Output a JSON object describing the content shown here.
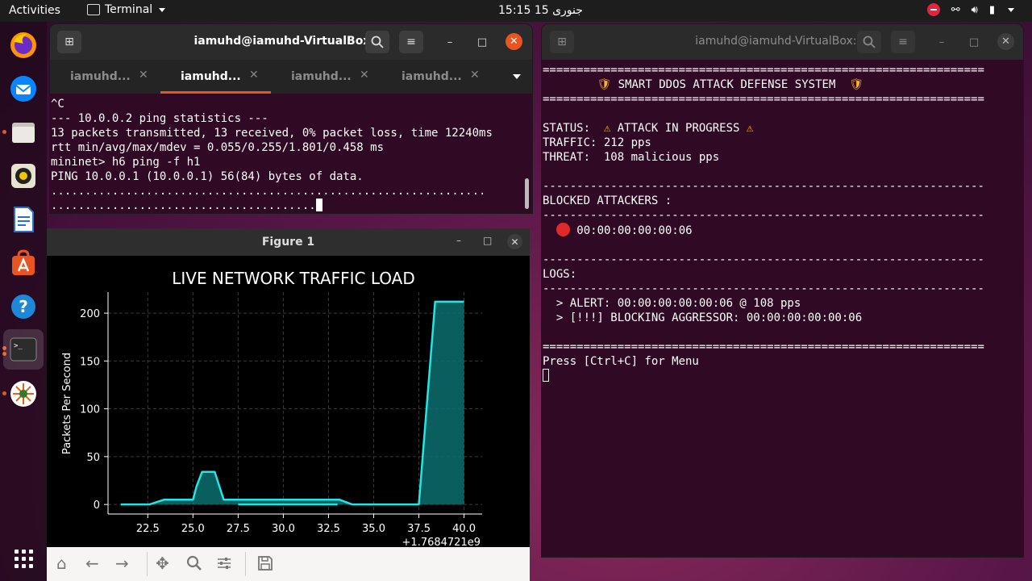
{
  "topbar": {
    "activities": "Activities",
    "app_name": "Terminal",
    "clock_time": "15:15",
    "clock_date": "15 جنوری"
  },
  "dock": {
    "items": [
      "firefox-icon",
      "thunderbird-icon",
      "files-icon",
      "rhythmbox-icon",
      "libreoffice-writer-icon",
      "ubuntu-software-icon",
      "help-icon",
      "terminal-icon",
      "wireshark-icon",
      "show-apps-icon"
    ]
  },
  "terminal_left": {
    "title": "iamuhd@iamuhd-VirtualBox: ~",
    "tabs": [
      {
        "label": "iamuhd..."
      },
      {
        "label": "iamuhd..."
      },
      {
        "label": "iamuhd..."
      },
      {
        "label": "iamuhd..."
      }
    ],
    "lines": [
      "^C",
      "--- 10.0.0.2 ping statistics ---",
      "13 packets transmitted, 13 received, 0% packet loss, time 12240ms",
      "rtt min/avg/max/mdev = 0.055/0.255/1.801/0.458 ms",
      "mininet> h6 ping -f h1",
      "PING 10.0.0.1 (10.0.0.1) 56(84) bytes of data.",
      "................................................................",
      "......................................."
    ]
  },
  "terminal_right": {
    "title": "iamuhd@iamuhd-VirtualBox: ~",
    "separator_eq": "=================================================================",
    "separator_dash": "-----------------------------------------------------------------",
    "banner": " SMART DDOS ATTACK DEFENSE SYSTEM ",
    "status_label": "STATUS:  ",
    "status_value": " ATTACK IN PROGRESS ",
    "traffic_line": "TRAFFIC: 212 pps",
    "threat_line": "THREAT:  108 malicious pps",
    "blocked_header": "BLOCKED ATTACKERS :",
    "blocked_entry": "00:00:00:00:00:06",
    "logs_header": "LOGS:",
    "log_lines": [
      "  > ALERT: 00:00:00:00:00:06 @ 108 pps",
      "  > [!!!] BLOCKING AGGRESSOR: 00:00:00:00:00:06"
    ],
    "prompt": "Press [Ctrl+C] for Menu"
  },
  "figure": {
    "title": "Figure 1",
    "toolbar": [
      "home-icon",
      "back-icon",
      "forward-icon",
      "pan-icon",
      "zoom-icon",
      "configure-icon",
      "save-icon"
    ]
  },
  "chart_data": {
    "type": "area",
    "title": "LIVE NETWORK TRAFFIC LOAD",
    "xlabel": "",
    "ylabel": "Packets Per Second",
    "x_offset_label": "+1.7684721e9",
    "xlim": [
      20.3,
      41.0
    ],
    "ylim": [
      -10,
      222
    ],
    "xticks": [
      22.5,
      25.0,
      27.5,
      30.0,
      32.5,
      35.0,
      37.5,
      40.0
    ],
    "xtick_labels": [
      "22.5",
      "25.0",
      "27.5",
      "30.0",
      "32.5",
      "35.0",
      "37.5",
      "40.0"
    ],
    "yticks": [
      0,
      50,
      100,
      150,
      200
    ],
    "ytick_labels": [
      "0",
      "50",
      "100",
      "150",
      "200"
    ],
    "grid": true,
    "line_color": "#22e5e5",
    "fill_color": "#0c6e6e",
    "series": [
      {
        "x": [
          21.0,
          22.1,
          22.6,
          23.4,
          24.6,
          25.0,
          25.2,
          25.5,
          26.0,
          26.2,
          26.7,
          27.9,
          30.0,
          32.5,
          33.1,
          33.8,
          35.0,
          36.0,
          37.5,
          38.4,
          40.0
        ],
        "y": [
          0,
          0,
          0,
          5,
          5,
          5,
          19,
          34,
          34,
          34,
          5,
          5,
          5,
          5,
          5,
          0,
          0,
          0,
          0,
          212,
          212
        ]
      },
      {
        "x": [
          27.5,
          30.0,
          32.5,
          33.0
        ],
        "y": [
          0,
          0,
          0,
          0
        ]
      }
    ]
  }
}
